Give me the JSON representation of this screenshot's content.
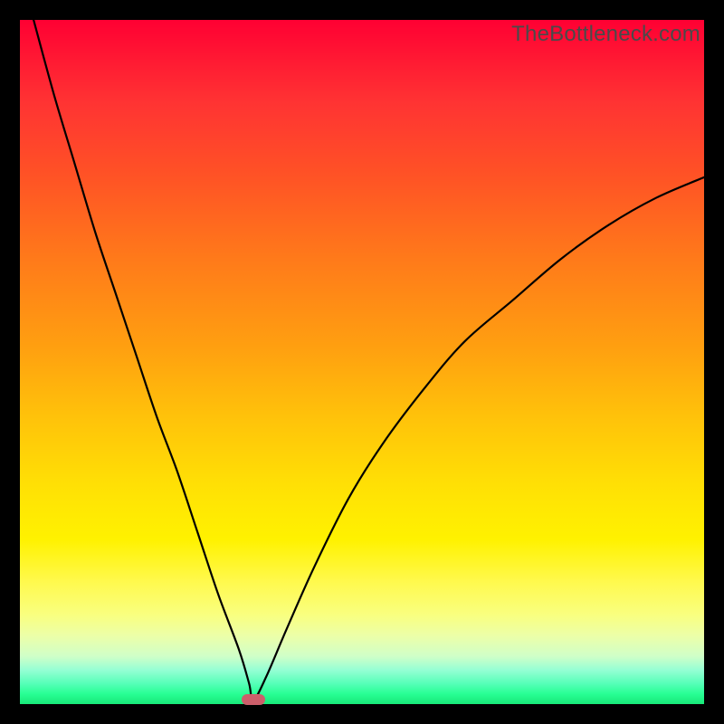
{
  "watermark": "TheBottleneck.com",
  "chart_data": {
    "type": "line",
    "title": "",
    "xlabel": "",
    "ylabel": "",
    "xlim": [
      0,
      100
    ],
    "ylim": [
      0,
      100
    ],
    "grid": false,
    "legend": false,
    "gradient_meaning": "top=red (high bottleneck), bottom=green (optimal)",
    "series": [
      {
        "name": "left-branch",
        "x": [
          2,
          5,
          8,
          11,
          14,
          17,
          20,
          23,
          26,
          29,
          32,
          33.5,
          34.1
        ],
        "y": [
          100,
          89,
          79,
          69,
          60,
          51,
          42,
          34,
          25,
          16,
          8,
          3,
          0.5
        ]
      },
      {
        "name": "right-branch",
        "x": [
          34.1,
          36,
          39,
          43,
          48,
          53,
          59,
          65,
          72,
          79,
          86,
          93,
          100
        ],
        "y": [
          0.5,
          4,
          11,
          20,
          30,
          38,
          46,
          53,
          59,
          65,
          70,
          74,
          77
        ]
      }
    ],
    "minimum_point": {
      "x": 34.1,
      "y": 0.5
    },
    "marker": {
      "center_x_pct": 34.1,
      "center_y_pct": 0.65,
      "color": "#cc5e6a",
      "shape": "rounded-rect"
    }
  }
}
